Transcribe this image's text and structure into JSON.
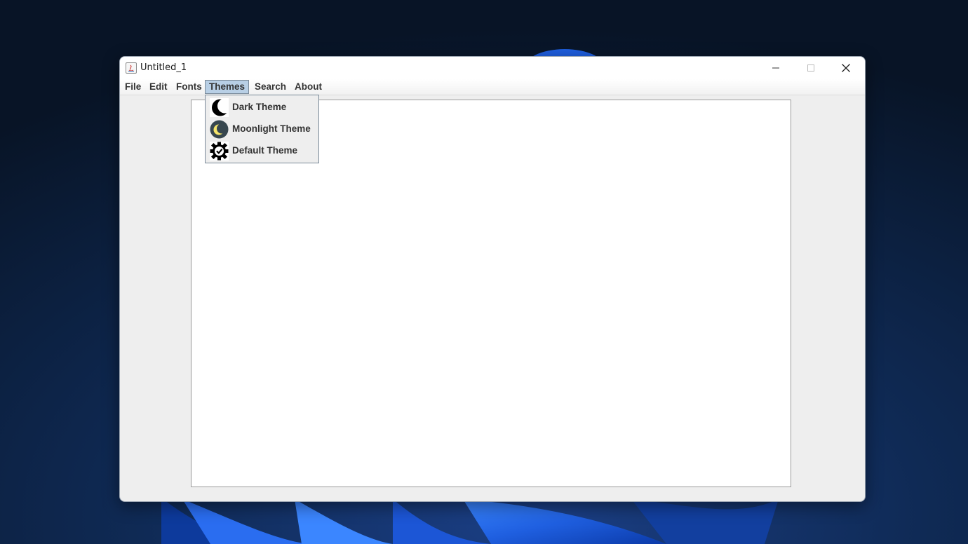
{
  "window": {
    "title": "Untitled_1",
    "controls": [
      "minimize",
      "maximize",
      "close"
    ]
  },
  "menubar": {
    "items": [
      {
        "label": "File"
      },
      {
        "label": "Edit"
      },
      {
        "label": "Fonts"
      },
      {
        "label": "Themes",
        "active": true
      },
      {
        "label": "Search"
      },
      {
        "label": "About"
      }
    ]
  },
  "themes_menu": {
    "items": [
      {
        "label": "Dark Theme",
        "icon": "crescent-moon-icon"
      },
      {
        "label": "Moonlight Theme",
        "icon": "moonlight-icon"
      },
      {
        "label": "Default Theme",
        "icon": "gear-check-icon"
      }
    ]
  },
  "editor": {
    "content": ""
  },
  "colors": {
    "desktop": "#0a1a33",
    "wallpaper_accent": "#1f5fe0",
    "menu_highlight": "#b8cfe5",
    "window_bg": "#eeeeee"
  }
}
